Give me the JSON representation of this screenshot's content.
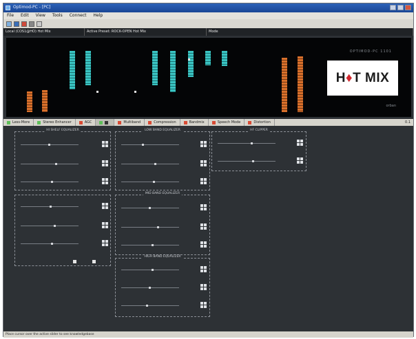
{
  "window": {
    "title": "Optimod-PC - [PC]"
  },
  "menu": {
    "items": [
      "File",
      "Edit",
      "View",
      "Tools",
      "Connect",
      "Help"
    ]
  },
  "infobar": {
    "local": "Local (COS1@HO) Hot Mix",
    "active_preset": "Active Preset: ROCK-OPEN Hot Mix",
    "mode": "Mode"
  },
  "meters": {
    "ghost_text": "OPTIMOD-PC 1101",
    "ghost_text2": "orban",
    "logo_text_prefix": "H",
    "logo_text_flame": "♦",
    "logo_text_suffix": "T MIX",
    "colors": {
      "cyan": "#3ac4c2",
      "orange": "#d9702b"
    }
  },
  "tabs": [
    {
      "label": "Less-More",
      "led": "#5fbf5a"
    },
    {
      "label": "Stereo Enhancer",
      "led": "#5fbf5a"
    },
    {
      "label": "AGC",
      "led": "#d84b34"
    },
    {
      "label": "",
      "led": "#5fbf5a"
    },
    {
      "label": "Multiband",
      "led": "#d84b34"
    },
    {
      "label": "Compression",
      "led": "#d84b34"
    },
    {
      "label": "Bandmix",
      "led": "#d84b34"
    },
    {
      "label": "Speech Mode",
      "led": "#d84b34"
    },
    {
      "label": "Distortion",
      "led": "#d84b34"
    }
  ],
  "tabs_right_label": "0.1",
  "panels": {
    "p1_title": "HI SHELF EQUALIZER",
    "p2_title": "LOW BAND EQUALIZER",
    "p3_title": "HF CLIPPER",
    "p4_title": "MID BAND EQUALIZER",
    "p5_title": "HIGH BAND EQUALIZER"
  },
  "status": {
    "text": "Place cursor over the active slider to see knowledgebase"
  }
}
